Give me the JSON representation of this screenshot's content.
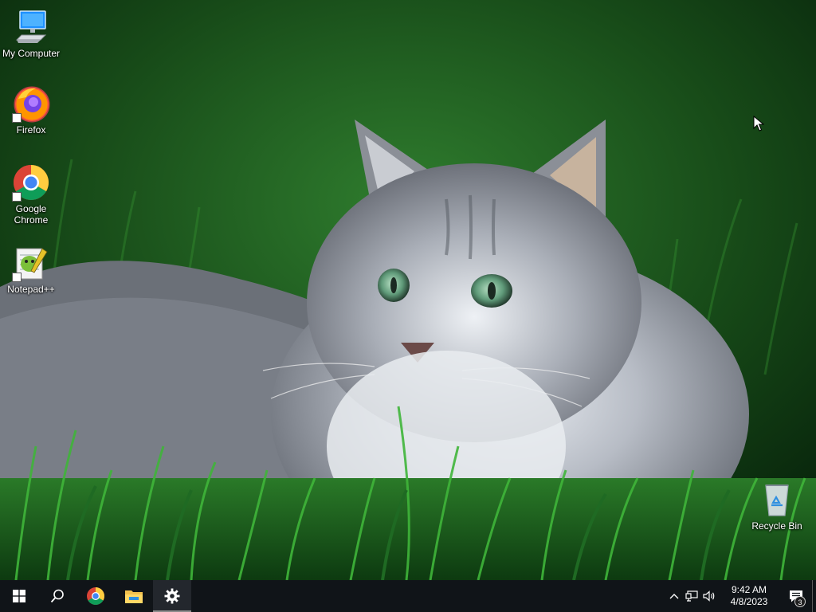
{
  "desktop": {
    "icons": [
      {
        "label": "My Computer",
        "icon": "computer-icon"
      },
      {
        "label": "Firefox",
        "icon": "firefox-icon"
      },
      {
        "label": "Google Chrome",
        "icon": "chrome-icon"
      },
      {
        "label": "Notepad++",
        "icon": "notepadpp-icon"
      },
      {
        "label": "Recycle Bin",
        "icon": "recycle-bin-icon"
      }
    ]
  },
  "taskbar": {
    "start": {
      "icon": "windows-logo-icon"
    },
    "search": {
      "icon": "search-icon"
    },
    "pinned": [
      {
        "icon": "chrome-icon",
        "active": false
      },
      {
        "icon": "file-explorer-icon",
        "active": false
      },
      {
        "icon": "settings-gear-icon",
        "active": true
      }
    ],
    "tray": {
      "icons": [
        "chevron-up-icon",
        "network-icon",
        "volume-icon"
      ],
      "time": "9:42 AM",
      "date": "4/8/2023",
      "notifications_count": "3"
    }
  },
  "colors": {
    "taskbar_bg": "#101418",
    "grass_dark": "#0b2a0f",
    "grass_mid": "#1f6a23",
    "cat_gray": "#8a8f98"
  }
}
